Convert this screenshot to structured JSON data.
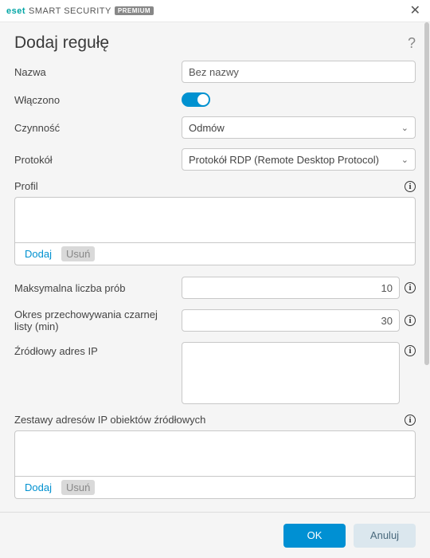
{
  "brand": {
    "eset": "eset",
    "product": "SMART SECURITY",
    "badge": "PREMIUM"
  },
  "title": "Dodaj regułę",
  "labels": {
    "name": "Nazwa",
    "enabled": "Włączono",
    "action": "Czynność",
    "protocol": "Protokół",
    "profile": "Profil",
    "maxAttempts": "Maksymalna liczba prób",
    "blacklistPeriod": "Okres przechowywania czarnej listy (min)",
    "sourceIp": "Źródłowy adres IP",
    "sourceIpSets": "Zestawy adresów IP obiektów źródłowych"
  },
  "values": {
    "name": "Bez nazwy",
    "enabled": true,
    "action": "Odmów",
    "protocol": "Protokół RDP (Remote Desktop Protocol)",
    "maxAttempts": "10",
    "blacklistPeriod": "30"
  },
  "buttons": {
    "add": "Dodaj",
    "delete": "Usuń",
    "ok": "OK",
    "cancel": "Anuluj"
  }
}
